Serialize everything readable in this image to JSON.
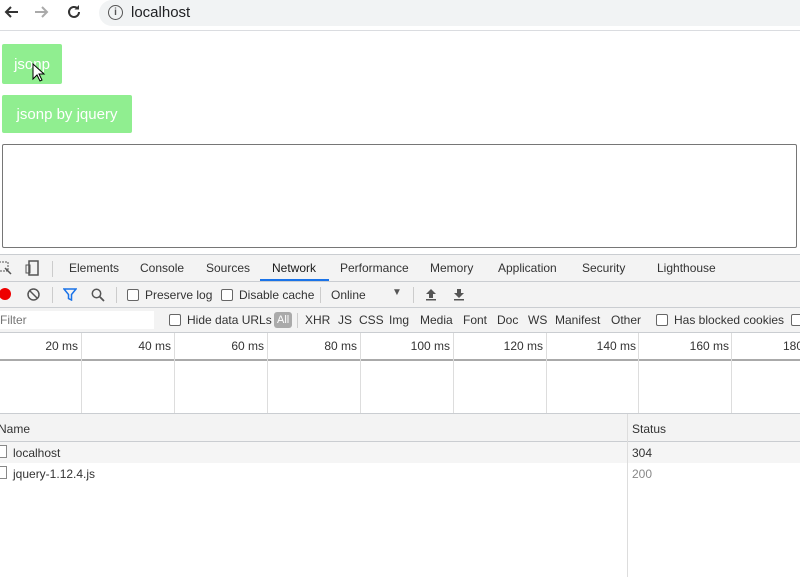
{
  "browser": {
    "back_icon": "back-arrow-icon",
    "forward_icon": "forward-arrow-icon",
    "reload_icon": "reload-icon",
    "url": "localhost"
  },
  "page": {
    "jsonp_button": "jsonp",
    "jsonp_jquery_button": "jsonp by jquery",
    "button_color": "#90ee90"
  },
  "devtools": {
    "tabs": [
      "Elements",
      "Console",
      "Sources",
      "Network",
      "Performance",
      "Memory",
      "Application",
      "Security",
      "Lighthouse"
    ],
    "active_tab": "Network",
    "toolbar": {
      "preserve_log": "Preserve log",
      "disable_cache": "Disable cache",
      "throttle": "Online"
    },
    "filter": {
      "placeholder": "Filter",
      "hide_data_urls": "Hide data URLs",
      "all": "All",
      "types": [
        "XHR",
        "JS",
        "CSS",
        "Img",
        "Media",
        "Font",
        "Doc",
        "WS",
        "Manifest",
        "Other"
      ],
      "has_blocked_cookies": "Has blocked cookies"
    },
    "timeline_ticks": [
      "20 ms",
      "40 ms",
      "60 ms",
      "80 ms",
      "100 ms",
      "120 ms",
      "140 ms",
      "160 ms",
      "180"
    ],
    "columns": {
      "name": "Name",
      "status": "Status"
    },
    "requests": [
      {
        "name": "localhost",
        "status": "304"
      },
      {
        "name": "jquery-1.12.4.js",
        "status": "200"
      }
    ]
  }
}
